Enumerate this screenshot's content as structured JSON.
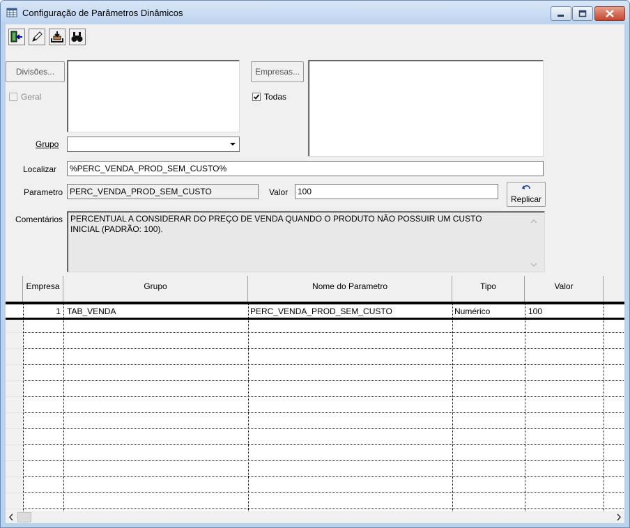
{
  "window": {
    "title": "Configuração de Parâmetros Dinâmicos",
    "controls": [
      "minimize-icon",
      "maximize-icon",
      "close-icon"
    ]
  },
  "toolbar": {
    "buttons": [
      {
        "name": "exit-button",
        "icon": "exit-door-icon"
      },
      {
        "name": "edit-button",
        "icon": "pencil-icon"
      },
      {
        "name": "save-button",
        "icon": "save-tray-icon"
      },
      {
        "name": "find-button",
        "icon": "binoculars-icon"
      }
    ]
  },
  "form": {
    "divisoes_button": "Divisões...",
    "geral_label": "Geral",
    "geral_checked": false,
    "empresas_button": "Empresas...",
    "todas_label": "Todas",
    "todas_checked": true,
    "grupo_label": "Grupo",
    "grupo_value": "",
    "localizar_label": "Localizar",
    "localizar_value": "%PERC_VENDA_PROD_SEM_CUSTO%",
    "parametro_label": "Parametro",
    "parametro_value": "PERC_VENDA_PROD_SEM_CUSTO",
    "valor_label": "Valor",
    "valor_value": "100",
    "replicar_button": "Replicar",
    "comentarios_label": "Comentários",
    "comentarios_value": "PERCENTUAL A CONSIDERAR DO PREÇO DE VENDA QUANDO O PRODUTO NÃO POSSUIR UM CUSTO INICIAL (PADRÃO: 100)."
  },
  "grid": {
    "columns": [
      "Empresa",
      "Grupo",
      "Nome do Parametro",
      "Tipo",
      "Valor"
    ],
    "rows": [
      {
        "empresa": "1",
        "grupo": "TAB_VENDA",
        "nome": "PERC_VENDA_PROD_SEM_CUSTO",
        "tipo": "Numérico",
        "valor": "100"
      }
    ]
  },
  "colors": {
    "titlebar": "#bcd3ee",
    "face": "#f0f0f0",
    "close_button": "#c2452c"
  }
}
